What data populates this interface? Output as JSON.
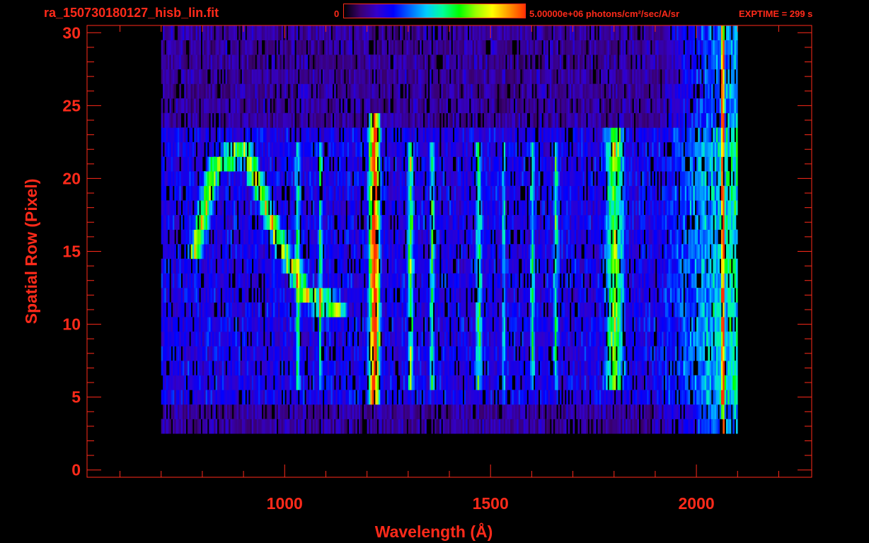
{
  "header": {
    "filename": "ra_150730180127_hisb_lin.fit",
    "colorbar_min_label": "0",
    "colorbar_max_label": "5.00000e+06 photons/cm²/sec/A/sr",
    "exptime_label": "EXPTIME = 299 s"
  },
  "colors": {
    "axis": "#ff2a1a",
    "background": "#000000",
    "colormap": [
      "#000000",
      "#3a0070",
      "#3300cc",
      "#0000ff",
      "#0066ff",
      "#00ccff",
      "#00ff99",
      "#00ff00",
      "#99ff00",
      "#ffff00",
      "#ff9900",
      "#ff3300"
    ]
  },
  "chart_data": {
    "type": "heatmap",
    "title": "",
    "xlabel": "Wavelength (Å)",
    "ylabel": "Spatial Row (Pixel)",
    "xlim": [
      520,
      2280
    ],
    "ylim": [
      -0.5,
      30.5
    ],
    "x_ticks": [
      1000,
      1500,
      2000
    ],
    "y_ticks": [
      0,
      5,
      10,
      15,
      20,
      25,
      30
    ],
    "x_minor_step": 100,
    "y_minor_step": 1,
    "colorbar": {
      "min": 0,
      "max": 5000000,
      "units": "photons/cm²/sec/A/sr"
    },
    "data_extent": {
      "x": [
        700,
        2100
      ],
      "rows": [
        3,
        30
      ]
    },
    "bright_band_rows": [
      5,
      23
    ],
    "features": [
      {
        "name": "Lyman-alpha",
        "x": 1216,
        "rows": [
          5,
          24
        ],
        "level": 0.95,
        "width": 18
      },
      {
        "name": "arc",
        "points": [
          [
            780,
            15
          ],
          [
            830,
            21
          ],
          [
            900,
            22
          ],
          [
            980,
            16
          ],
          [
            1050,
            12
          ],
          [
            1130,
            11
          ]
        ],
        "level": 0.55,
        "width": 22
      },
      {
        "x": 1030,
        "rows": [
          6,
          22
        ],
        "level": 0.4,
        "width": 8
      },
      {
        "x": 1085,
        "rows": [
          6,
          22
        ],
        "level": 0.35,
        "width": 6
      },
      {
        "x": 1304,
        "rows": [
          6,
          22
        ],
        "level": 0.45,
        "width": 10
      },
      {
        "x": 1356,
        "rows": [
          6,
          22
        ],
        "level": 0.38,
        "width": 8
      },
      {
        "x": 1470,
        "rows": [
          6,
          22
        ],
        "level": 0.4,
        "width": 10
      },
      {
        "x": 1530,
        "rows": [
          6,
          22
        ],
        "level": 0.3,
        "width": 6
      },
      {
        "x": 1600,
        "rows": [
          6,
          22
        ],
        "level": 0.3,
        "width": 8
      },
      {
        "x": 1657,
        "rows": [
          6,
          22
        ],
        "level": 0.35,
        "width": 8
      },
      {
        "x": 1800,
        "rows": [
          6,
          23
        ],
        "level": 0.5,
        "width": 30
      },
      {
        "x": 2062,
        "rows": [
          2,
          30
        ],
        "level": 0.85,
        "width": 5
      }
    ]
  }
}
